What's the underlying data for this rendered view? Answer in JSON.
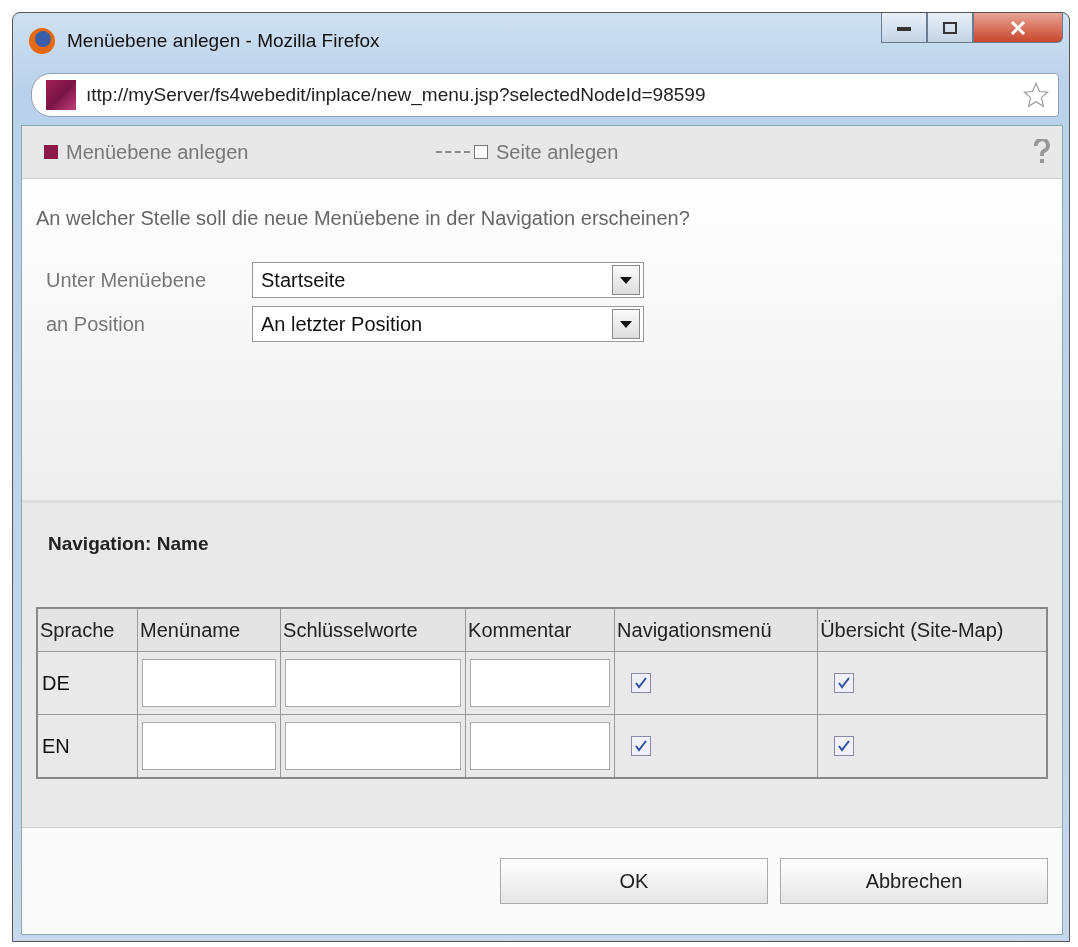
{
  "window": {
    "title": "Menüebene anlegen - Mozilla Firefox"
  },
  "address_bar": {
    "value": "ıttp://myServer/fs4webedit/inplace/new_menu.jsp?selectedNodeId=98599"
  },
  "steps": [
    {
      "label": "Menüebene anlegen",
      "selected": true
    },
    {
      "label": "Seite anlegen",
      "selected": false
    }
  ],
  "question": "An welcher Stelle soll die neue Menüebene in der Navigation erscheinen?",
  "fields": [
    {
      "label": "Unter Menüebene",
      "value": "Startseite"
    },
    {
      "label": "an Position",
      "value": "An letzter Position"
    }
  ],
  "section_title": "Navigation: Name",
  "table": {
    "columns": [
      "Sprache",
      "Menüname",
      "Schlüsselworte",
      "Kommentar",
      "Navigationsmenü",
      "Übersicht (Site-Map)"
    ],
    "rows": [
      {
        "language": "DE",
        "navigation_menu": true,
        "site_map": true
      },
      {
        "language": "EN",
        "navigation_menu": true,
        "site_map": true
      }
    ]
  },
  "buttons": [
    "OK",
    "Abbrechen"
  ]
}
